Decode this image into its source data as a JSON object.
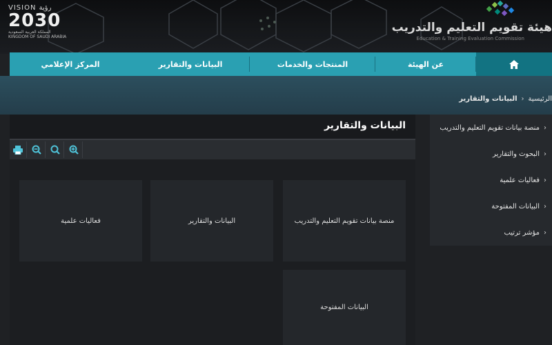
{
  "header": {
    "vision_logo": {
      "top": "VISION رؤية",
      "year": "2030",
      "sub_ar": "المملكة العربية السعودية",
      "sub_en": "KINGDOM OF SAUDI ARABIA"
    },
    "org_name": "هيئة تقويم التعليم والتدريب",
    "org_sub": "Education & Training Evaluation Commission"
  },
  "nav": {
    "home_icon": "home-icon",
    "items": [
      "عن الهيئة",
      "المنتجات والخدمات",
      "البيانات والتقارير",
      "المركز الإعلامي"
    ]
  },
  "breadcrumb": {
    "home": "الرئيسية",
    "current": "البيانات والتقارير"
  },
  "sidebar": {
    "items": [
      "منصة بيانات تقويم التعليم والتدريب",
      "البحوث والتقارير",
      "فعاليات علمية",
      "البيانات المفتوحة",
      "مؤشر ترتيب"
    ]
  },
  "panel": {
    "title": "البيانات والتقارير"
  },
  "toolbar": {
    "icons": [
      "print-icon",
      "zoom-out-icon",
      "zoom-reset-icon",
      "zoom-in-icon"
    ]
  },
  "tiles": [
    "منصة بيانات تقويم التعليم والتدريب",
    "البيانات والتقارير",
    "فعاليات علمية",
    "البيانات المفتوحة"
  ],
  "colors": {
    "nav": "#2aa0b2",
    "nav_active": "#127382",
    "band": "#2c4f5e",
    "bg": "#1f2124"
  }
}
